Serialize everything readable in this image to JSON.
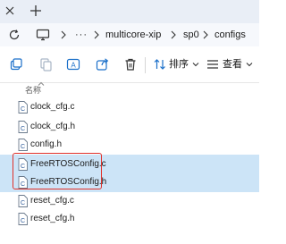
{
  "tabbar": {
    "close_icon": "close-icon",
    "add_icon": "plus-icon"
  },
  "address": {
    "refresh_icon": "refresh-icon",
    "computer_icon": "monitor-icon",
    "ellipsis": "···",
    "crumbs": [
      "multicore-xip",
      "sp0",
      "configs"
    ]
  },
  "toolbar": {
    "sort_label": "排序",
    "view_label": "查看",
    "icons": [
      "new-item-icon",
      "copy-icon",
      "rename-icon",
      "share-icon",
      "delete-icon",
      "sort-icon",
      "view-icon"
    ]
  },
  "columns": {
    "name": "名称"
  },
  "files": [
    {
      "name": "clock_cfg.c",
      "selected": false
    },
    {
      "name": "clock_cfg.h",
      "selected": false
    },
    {
      "name": "config.h",
      "selected": false
    },
    {
      "name": "FreeRTOSConfig.c",
      "selected": true
    },
    {
      "name": "FreeRTOSConfig.h",
      "selected": true
    },
    {
      "name": "reset_cfg.c",
      "selected": false
    },
    {
      "name": "reset_cfg.h",
      "selected": false
    }
  ],
  "colors": {
    "selection": "#cce4f7",
    "highlight_border": "#e0312a",
    "tabbar_bg": "#e9eef6"
  }
}
